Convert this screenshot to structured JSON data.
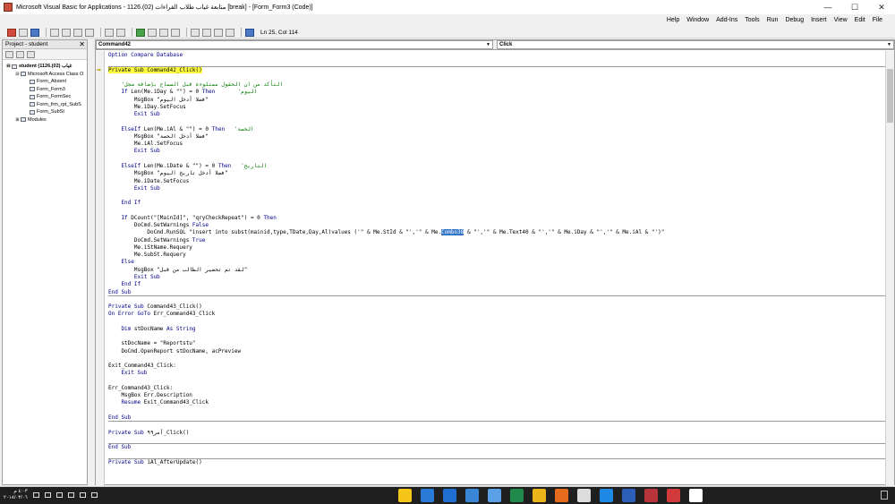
{
  "window": {
    "title": "Microsoft Visual Basic for Applications - 1126.(02) متابعة غياب طلاب القراءات [break] - [Form_Form3 (Code)]",
    "controls": {
      "minimize": "—",
      "maximize": "☐",
      "close": "✕"
    }
  },
  "menu": [
    "Help",
    "Window",
    "Add-Ins",
    "Tools",
    "Run",
    "Debug",
    "Insert",
    "View",
    "Edit",
    "File"
  ],
  "toolbar": {
    "position": "Ln 25, Col 114"
  },
  "project": {
    "header": "Project - student",
    "close": "✕",
    "tree": [
      {
        "label": "student (1126.(02) غياب",
        "level": 0,
        "expander": "⊟",
        "bold": true
      },
      {
        "label": "Microsoft Access Class O",
        "level": 1,
        "expander": "⊟"
      },
      {
        "label": "Form_Absent",
        "level": 2
      },
      {
        "label": "Form_Form3",
        "level": 2
      },
      {
        "label": "Form_FormSec",
        "level": 2
      },
      {
        "label": "Form_frm_rpt_SubS",
        "level": 2
      },
      {
        "label": "Form_SubSt",
        "level": 2
      },
      {
        "label": "Modules",
        "level": 1,
        "expander": "⊞"
      }
    ]
  },
  "code": {
    "object_combo": "Command42",
    "proc_combo": "Click",
    "lines": [
      {
        "segs": [
          {
            "t": "Option Compare Database",
            "c": "kw"
          }
        ]
      },
      {
        "segs": [
          {
            "t": ""
          }
        ],
        "sep": true
      },
      {
        "segs": [
          {
            "t": "Private Sub Command42_Click()",
            "c": "hl"
          }
        ],
        "pointer": true
      },
      {
        "segs": [
          {
            "t": ""
          }
        ]
      },
      {
        "segs": [
          {
            "t": "    'التأكد من ان الحقول ممتلوءة قبل السماح بإضافة سجل",
            "c": "cmt"
          }
        ]
      },
      {
        "segs": [
          {
            "t": "    If ",
            "c": "kw"
          },
          {
            "t": "Len(Me.iDay & \"\") = 0 "
          },
          {
            "t": "Then       ",
            "c": "kw"
          },
          {
            "t": "'اليوم",
            "c": "cmt"
          }
        ]
      },
      {
        "segs": [
          {
            "t": "        MsgBox \"فضلا أدخل اليوم\""
          }
        ]
      },
      {
        "segs": [
          {
            "t": "        Me.iDay.SetFocus"
          }
        ]
      },
      {
        "segs": [
          {
            "t": "        Exit Sub",
            "c": "kw"
          }
        ]
      },
      {
        "segs": [
          {
            "t": ""
          }
        ]
      },
      {
        "segs": [
          {
            "t": "    ElseIf ",
            "c": "kw"
          },
          {
            "t": "Len(Me.iAl & \"\") = 0 "
          },
          {
            "t": "Then   ",
            "c": "kw"
          },
          {
            "t": "'الحصة",
            "c": "cmt"
          }
        ]
      },
      {
        "segs": [
          {
            "t": "        MsgBox \"فضلا أدخل الحصة\""
          }
        ]
      },
      {
        "segs": [
          {
            "t": "        Me.iAl.SetFocus"
          }
        ]
      },
      {
        "segs": [
          {
            "t": "        Exit Sub",
            "c": "kw"
          }
        ]
      },
      {
        "segs": [
          {
            "t": ""
          }
        ]
      },
      {
        "segs": [
          {
            "t": "    ElseIf ",
            "c": "kw"
          },
          {
            "t": "Len(Me.iDate & \"\") = 0 "
          },
          {
            "t": "Then   ",
            "c": "kw"
          },
          {
            "t": "'التاريخ",
            "c": "cmt"
          }
        ]
      },
      {
        "segs": [
          {
            "t": "        MsgBox \"فضلا أدخل تاريخ اليوم\""
          }
        ]
      },
      {
        "segs": [
          {
            "t": "        Me.iDate.SetFocus"
          }
        ]
      },
      {
        "segs": [
          {
            "t": "        Exit Sub",
            "c": "kw"
          }
        ]
      },
      {
        "segs": [
          {
            "t": ""
          }
        ]
      },
      {
        "segs": [
          {
            "t": "    End If",
            "c": "kw"
          }
        ]
      },
      {
        "segs": [
          {
            "t": ""
          }
        ]
      },
      {
        "segs": [
          {
            "t": "    If ",
            "c": "kw"
          },
          {
            "t": "DCount(\"[MainId]\", \"qryCheckRepeat\") = 0 "
          },
          {
            "t": "Then",
            "c": "kw"
          }
        ]
      },
      {
        "segs": [
          {
            "t": "        DoCmd.SetWarnings "
          },
          {
            "t": "False",
            "c": "kw"
          }
        ]
      },
      {
        "segs": [
          {
            "t": "            DoCmd.RunSQL \"insert into subst(mainid,type,TDate,Day,Al)values ('\" & Me.StId & \"','\" & Me."
          },
          {
            "t": "Combo38",
            "c": "sel"
          },
          {
            "t": " & \"','\" & Me.Text40 & \"','\" & Me.iDay & \"','\" & Me.iAl & \"')\""
          }
        ]
      },
      {
        "segs": [
          {
            "t": "        DoCmd.SetWarnings "
          },
          {
            "t": "True",
            "c": "kw"
          }
        ]
      },
      {
        "segs": [
          {
            "t": "        Me.iStName.Requery"
          }
        ]
      },
      {
        "segs": [
          {
            "t": "        Me.SubSt.Requery"
          }
        ]
      },
      {
        "segs": [
          {
            "t": "    Else",
            "c": "kw"
          }
        ]
      },
      {
        "segs": [
          {
            "t": "        MsgBox \"لقد تم تحضير الطالب من قبل\""
          }
        ]
      },
      {
        "segs": [
          {
            "t": "        Exit Sub",
            "c": "kw"
          }
        ]
      },
      {
        "segs": [
          {
            "t": "    End If",
            "c": "kw"
          }
        ]
      },
      {
        "segs": [
          {
            "t": "End Sub",
            "c": "kw"
          }
        ],
        "sep": true
      },
      {
        "segs": [
          {
            "t": ""
          }
        ]
      },
      {
        "segs": [
          {
            "t": "Private Sub ",
            "c": "kw"
          },
          {
            "t": "Command43_Click()"
          }
        ]
      },
      {
        "segs": [
          {
            "t": "On Error GoTo ",
            "c": "kw"
          },
          {
            "t": "Err_Command43_Click"
          }
        ]
      },
      {
        "segs": [
          {
            "t": ""
          }
        ]
      },
      {
        "segs": [
          {
            "t": "    Dim ",
            "c": "kw"
          },
          {
            "t": "stDocName "
          },
          {
            "t": "As String",
            "c": "kw"
          }
        ]
      },
      {
        "segs": [
          {
            "t": ""
          }
        ]
      },
      {
        "segs": [
          {
            "t": "    stDocName = \"Reportstu\""
          }
        ]
      },
      {
        "segs": [
          {
            "t": "    DoCmd.OpenReport stDocName, acPreview"
          }
        ]
      },
      {
        "segs": [
          {
            "t": ""
          }
        ]
      },
      {
        "segs": [
          {
            "t": "Exit_Command43_Click:"
          }
        ]
      },
      {
        "segs": [
          {
            "t": "    Exit Sub",
            "c": "kw"
          }
        ]
      },
      {
        "segs": [
          {
            "t": ""
          }
        ]
      },
      {
        "segs": [
          {
            "t": "Err_Command43_Click:"
          }
        ]
      },
      {
        "segs": [
          {
            "t": "    MsgBox Err.Description"
          }
        ]
      },
      {
        "segs": [
          {
            "t": "    Resume ",
            "c": "kw"
          },
          {
            "t": "Exit_Command43_Click"
          }
        ]
      },
      {
        "segs": [
          {
            "t": ""
          }
        ]
      },
      {
        "segs": [
          {
            "t": "End Sub",
            "c": "kw"
          }
        ],
        "sep": true
      },
      {
        "segs": [
          {
            "t": ""
          }
        ]
      },
      {
        "segs": [
          {
            "t": "Private Sub ",
            "c": "kw"
          },
          {
            "t": "أمر٩٩_Click()"
          }
        ]
      },
      {
        "segs": [
          {
            "t": ""
          }
        ],
        "sep": true
      },
      {
        "segs": [
          {
            "t": "End Sub",
            "c": "kw"
          }
        ]
      },
      {
        "segs": [
          {
            "t": ""
          }
        ],
        "sep": true
      },
      {
        "segs": [
          {
            "t": "Private Sub ",
            "c": "kw"
          },
          {
            "t": "iAl_AfterUpdate()"
          }
        ]
      }
    ]
  },
  "taskbar": {
    "time": "٤:٠٣ م",
    "date": "٢٠١٨/٠٣/٠٦",
    "apps": [
      {
        "name": "file-explorer",
        "color": "#f5c518"
      },
      {
        "name": "teamviewer",
        "color": "#2a7bd8"
      },
      {
        "name": "outlook",
        "color": "#1f6fd0"
      },
      {
        "name": "store",
        "color": "#3a86d6"
      },
      {
        "name": "app-blue",
        "color": "#5aa0e6"
      },
      {
        "name": "excel",
        "color": "#1f8a4c"
      },
      {
        "name": "chrome",
        "color": "#e8b41a"
      },
      {
        "name": "firefox",
        "color": "#e66b1c"
      },
      {
        "name": "app-white",
        "color": "#dcdcdc"
      },
      {
        "name": "edge",
        "color": "#1e88e5"
      },
      {
        "name": "word",
        "color": "#2b5fb8"
      },
      {
        "name": "access",
        "color": "#b7353a"
      },
      {
        "name": "app-red",
        "color": "#d03a3a"
      },
      {
        "name": "start",
        "color": "#ffffff"
      }
    ]
  }
}
